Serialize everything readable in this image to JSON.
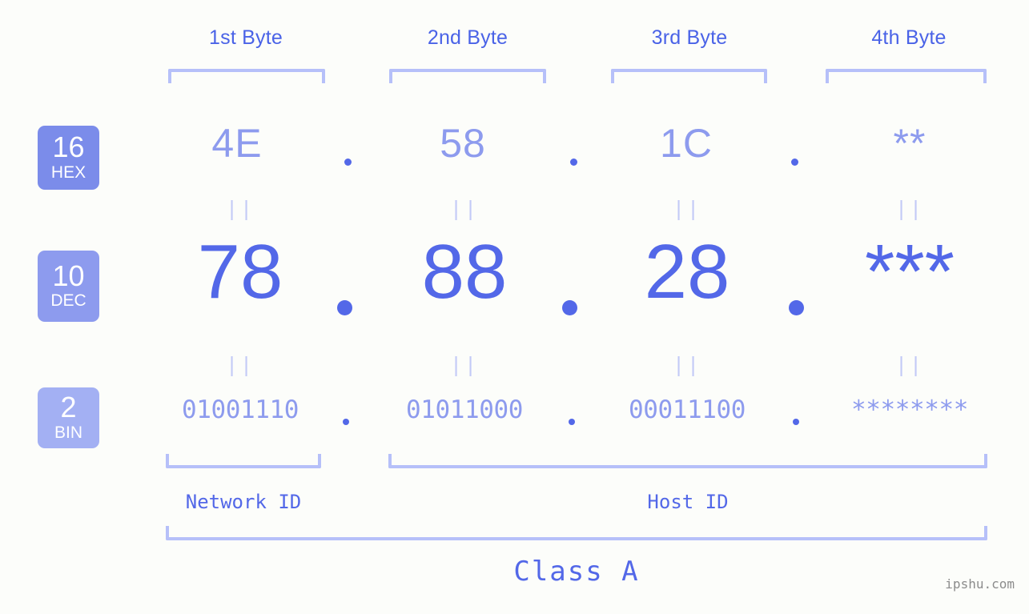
{
  "background": "#fcfdfa",
  "colors": {
    "label_blue": "#4a63e7",
    "bracket": "#b6c0f9",
    "value_light": "#8d9bee",
    "value_strong": "#5368e8",
    "eq_mark": "#c3caf7",
    "badge_hex": "#7b8cea",
    "badge_dec": "#8d9bee",
    "badge_bin": "#a3b0f3",
    "watermark": "#8c8c8c"
  },
  "byte_headers": [
    {
      "label": "1st Byte"
    },
    {
      "label": "2nd Byte"
    },
    {
      "label": "3rd Byte"
    },
    {
      "label": "4th Byte"
    }
  ],
  "bases": [
    {
      "number": "16",
      "name": "HEX"
    },
    {
      "number": "10",
      "name": "DEC"
    },
    {
      "number": "2",
      "name": "BIN"
    }
  ],
  "rows": {
    "hex": {
      "values": [
        "4E",
        "58",
        "1C",
        "**"
      ]
    },
    "dec": {
      "values": [
        "78",
        "88",
        "28",
        "***"
      ]
    },
    "bin": {
      "values": [
        "01001110",
        "01011000",
        "00011100",
        "********"
      ]
    }
  },
  "separator": ".",
  "equality_mark": "||",
  "segments": [
    {
      "label": "Network ID"
    },
    {
      "label": "Host ID"
    }
  ],
  "class": {
    "label": "Class A"
  },
  "watermark": {
    "text": "ipshu.com"
  }
}
